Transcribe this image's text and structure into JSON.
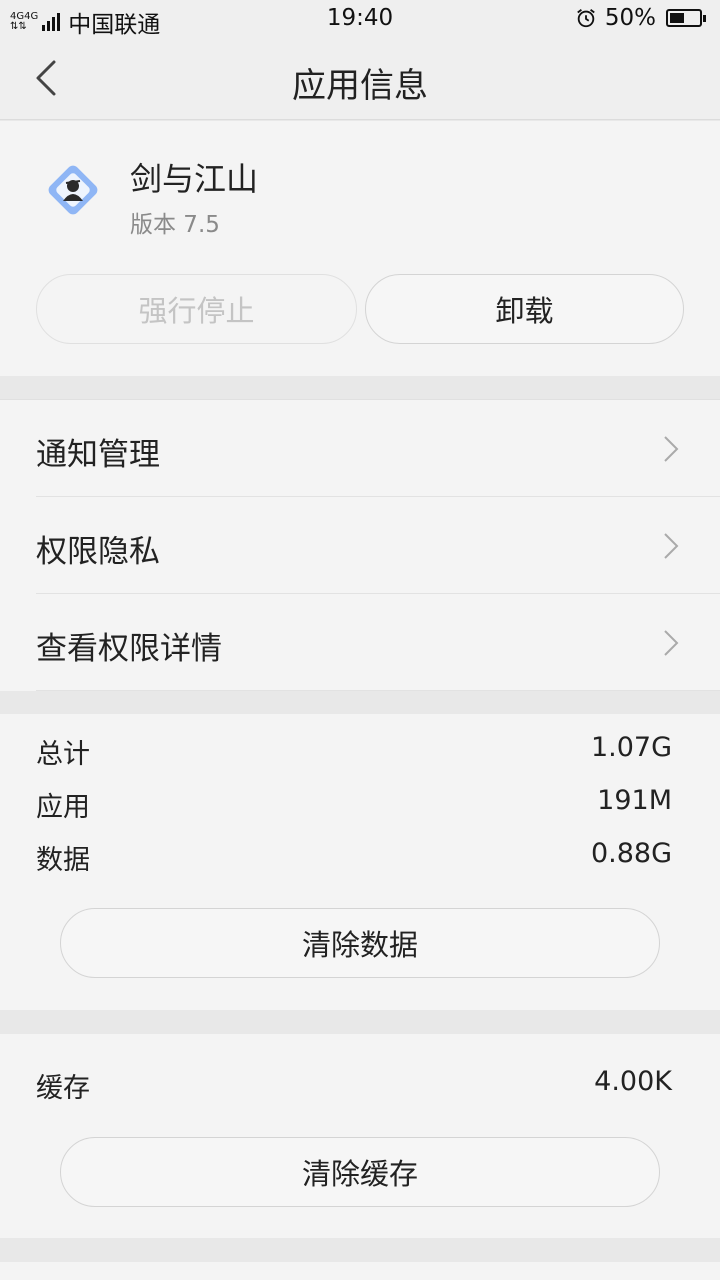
{
  "status_bar": {
    "network_left": "4G",
    "network_right": "4G",
    "carrier": "中国联通",
    "time": "19:40",
    "battery_percent": "50%",
    "battery_level": 0.5
  },
  "header": {
    "title": "应用信息"
  },
  "app": {
    "name": "剑与江山",
    "version": "版本 7.5",
    "force_stop_label": "强行停止",
    "uninstall_label": "卸载"
  },
  "menu": {
    "items": [
      {
        "label": "通知管理"
      },
      {
        "label": "权限隐私"
      },
      {
        "label": "查看权限详情"
      }
    ]
  },
  "storage": {
    "rows": [
      {
        "label": "总计",
        "value": "1.07G"
      },
      {
        "label": "应用",
        "value": "191M"
      },
      {
        "label": "数据",
        "value": "0.88G"
      }
    ],
    "clear_data_label": "清除数据"
  },
  "cache": {
    "label": "缓存",
    "value": "4.00K",
    "clear_cache_label": "清除缓存"
  },
  "colors": {
    "background": "#f4f4f4",
    "section_gap": "#e8e8e8",
    "app_icon_accent": "#8fb6f5"
  }
}
